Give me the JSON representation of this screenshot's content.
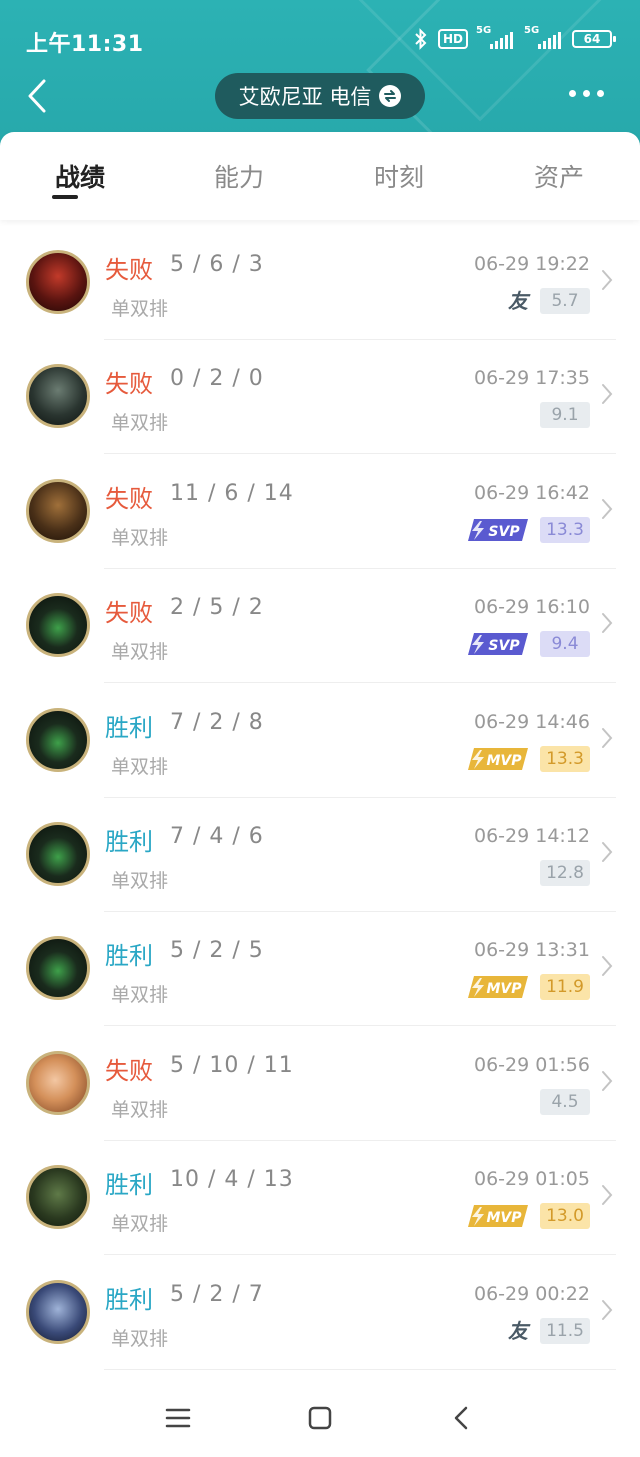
{
  "status_bar": {
    "time": "上午11:31",
    "hd_label": "HD",
    "net1": "5G",
    "net2": "5G",
    "battery": "64"
  },
  "header": {
    "server_name": "艾欧尼亚 电信",
    "back_icon": "chevron-left-icon",
    "swap_icon": "swap-icon",
    "more_icon": "more-dots-icon"
  },
  "tabs": [
    {
      "label": "战绩",
      "active": true
    },
    {
      "label": "能力",
      "active": false
    },
    {
      "label": "时刻",
      "active": false
    },
    {
      "label": "资产",
      "active": false
    }
  ],
  "matches": [
    {
      "result": "失败",
      "kda": "5 / 6 / 3",
      "mode": "单双排",
      "time": "06-29 19:22",
      "badge": "friend",
      "score": "5.7"
    },
    {
      "result": "失败",
      "kda": "0 / 2 / 0",
      "mode": "单双排",
      "time": "06-29 17:35",
      "badge": "",
      "score": "9.1"
    },
    {
      "result": "失败",
      "kda": "11 / 6 / 14",
      "mode": "单双排",
      "time": "06-29 16:42",
      "badge": "svp",
      "score": "13.3"
    },
    {
      "result": "失败",
      "kda": "2 / 5 / 2",
      "mode": "单双排",
      "time": "06-29 16:10",
      "badge": "svp",
      "score": "9.4"
    },
    {
      "result": "胜利",
      "kda": "7 / 2 / 8",
      "mode": "单双排",
      "time": "06-29 14:46",
      "badge": "mvp",
      "score": "13.3"
    },
    {
      "result": "胜利",
      "kda": "7 / 4 / 6",
      "mode": "单双排",
      "time": "06-29 14:12",
      "badge": "",
      "score": "12.8"
    },
    {
      "result": "胜利",
      "kda": "5 / 2 / 5",
      "mode": "单双排",
      "time": "06-29 13:31",
      "badge": "mvp",
      "score": "11.9"
    },
    {
      "result": "失败",
      "kda": "5 / 10 / 11",
      "mode": "单双排",
      "time": "06-29 01:56",
      "badge": "",
      "score": "4.5"
    },
    {
      "result": "胜利",
      "kda": "10 / 4 / 13",
      "mode": "单双排",
      "time": "06-29 01:05",
      "badge": "mvp",
      "score": "13.0"
    },
    {
      "result": "胜利",
      "kda": "5 / 2 / 7",
      "mode": "单双排",
      "time": "06-29 00:22",
      "badge": "friend",
      "score": "11.5"
    }
  ],
  "badge_labels": {
    "svp": "SVP",
    "mvp": "MVP",
    "friend": "友"
  },
  "colors": {
    "header": "#2cb2b4",
    "pill": "#1f5b5e",
    "lose": "#e65a3c",
    "win": "#2aa7c5",
    "mvp": "#e8b63a",
    "svp": "#5a5ad0"
  },
  "bottom_nav": [
    "menu-icon",
    "home-icon",
    "back-icon"
  ]
}
